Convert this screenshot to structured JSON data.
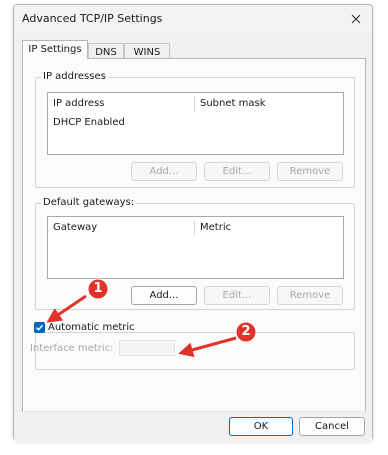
{
  "window": {
    "title": "Advanced TCP/IP Settings"
  },
  "tabs": [
    {
      "label": "IP Settings"
    },
    {
      "label": "DNS"
    },
    {
      "label": "WINS"
    }
  ],
  "ip_addresses": {
    "label": "IP addresses",
    "columns": [
      "IP address",
      "Subnet mask"
    ],
    "rows": [
      [
        "DHCP Enabled",
        ""
      ]
    ],
    "buttons": {
      "add": "Add...",
      "edit": "Edit...",
      "remove": "Remove"
    }
  },
  "default_gateways": {
    "label": "Default gateways:",
    "columns": [
      "Gateway",
      "Metric"
    ],
    "rows": [],
    "buttons": {
      "add": "Add...",
      "edit": "Edit...",
      "remove": "Remove"
    }
  },
  "automatic_metric": {
    "label": "Automatic metric",
    "checked": true
  },
  "interface_metric": {
    "label": "Interface metric:",
    "value": ""
  },
  "footer": {
    "ok": "OK",
    "cancel": "Cancel"
  },
  "annotations": {
    "badge1": "1",
    "badge2": "2",
    "color": "#e0342a"
  },
  "colors": {
    "accent": "#0067c0"
  }
}
